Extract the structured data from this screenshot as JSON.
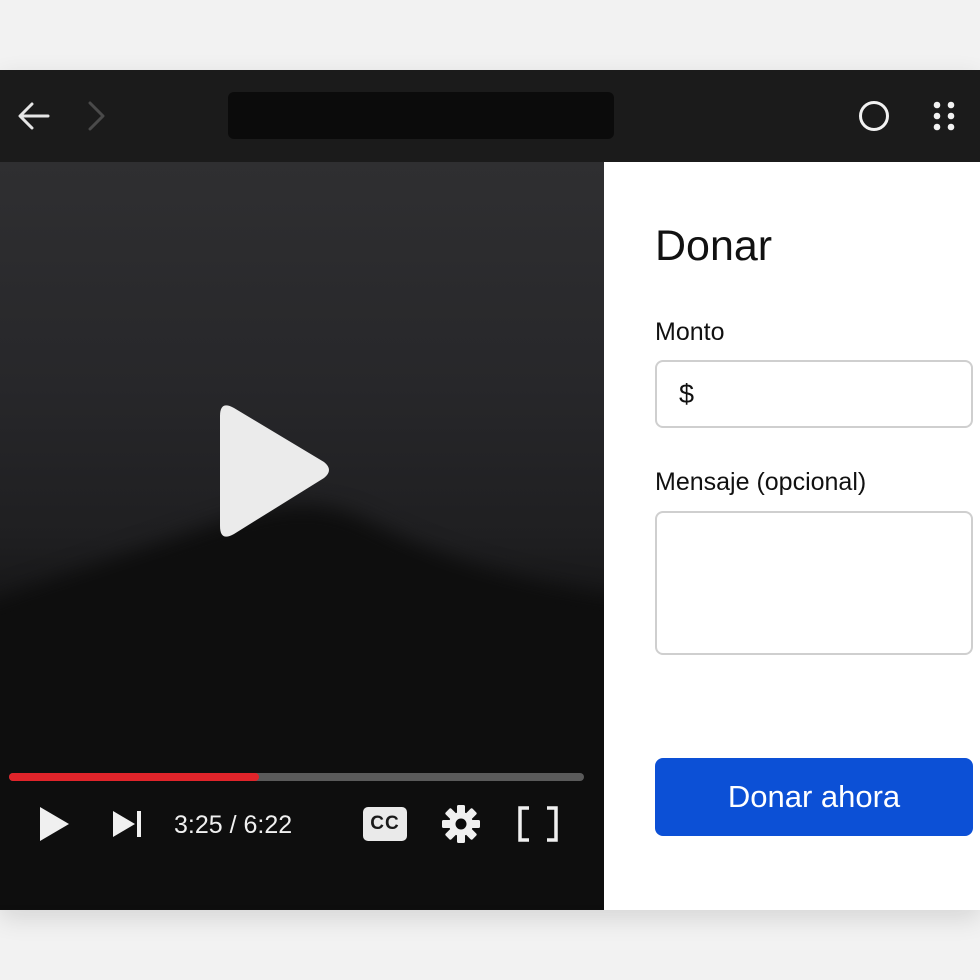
{
  "browser": {
    "address_value": ""
  },
  "video": {
    "current_time": "3:25",
    "separator": "/",
    "duration": "6:22",
    "progress_fraction": 0.4356,
    "cc_label": "CC",
    "progress_color": "#e0242a"
  },
  "donation": {
    "title": "Donar",
    "amount_label": "Monto",
    "currency_symbol": "$",
    "amount_value": "",
    "message_label": "Mensaje (opcional)",
    "message_value": "",
    "submit_label": "Donar ahora",
    "accent_color": "#0c50d6"
  },
  "icons": {
    "back": "arrow-left-icon",
    "forward": "arrow-right-icon",
    "profile": "circle-icon",
    "apps": "grid-dots-icon",
    "big_play": "play-icon",
    "play": "play-icon",
    "next": "skip-next-icon",
    "settings": "gear-icon",
    "fullscreen": "fullscreen-icon"
  }
}
